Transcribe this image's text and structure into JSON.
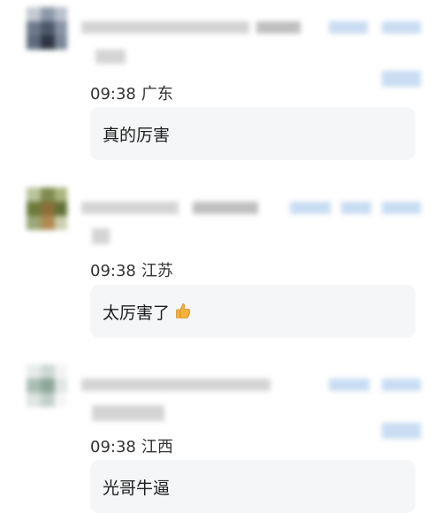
{
  "comments": [
    {
      "time": "09:38",
      "region": "广东",
      "text": "真的厉害",
      "has_emoji": false
    },
    {
      "time": "09:38",
      "region": "江苏",
      "text": "太厉害了",
      "has_emoji": true,
      "emoji": "thumbs-up-icon"
    },
    {
      "time": "09:38",
      "region": "江西",
      "text": "光哥牛逼",
      "has_emoji": false
    }
  ]
}
